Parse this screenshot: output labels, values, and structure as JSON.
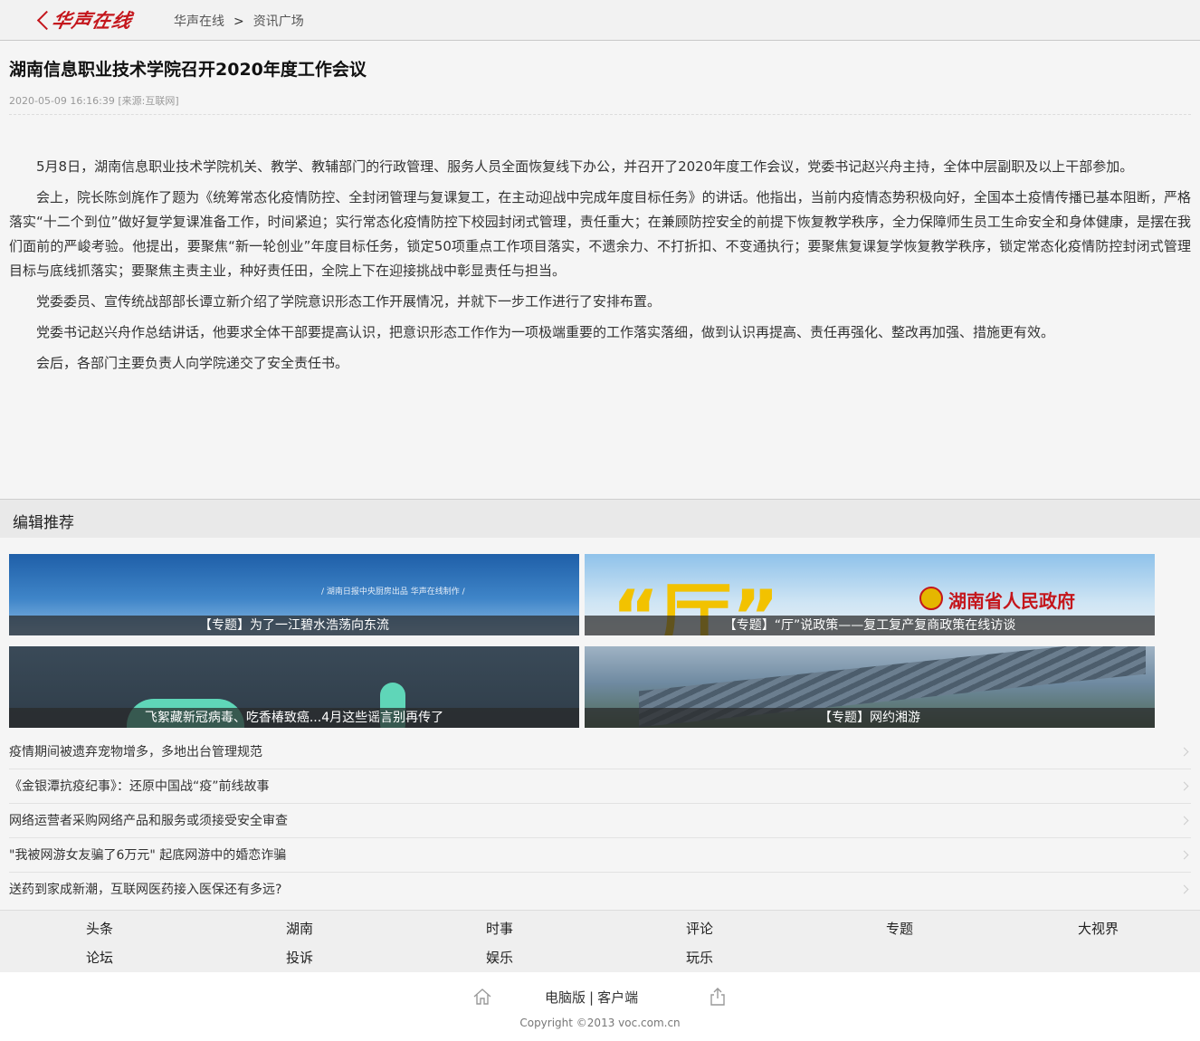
{
  "header": {
    "logo_text": "华声在线",
    "breadcrumb": [
      "华声在线",
      "资讯广场"
    ],
    "breadcrumb_sep": ">"
  },
  "article": {
    "title": "湖南信息职业技术学院召开2020年度工作会议",
    "meta": "2020-05-09 16:16:39 [来源:互联网]",
    "paragraphs": [
      "5月8日，湖南信息职业技术学院机关、教学、教辅部门的行政管理、服务人员全面恢复线下办公，并召开了2020年度工作会议，党委书记赵兴舟主持，全体中层副职及以上干部参加。",
      "会上，院长陈剑旄作了题为《统筹常态化疫情防控、全封闭管理与复课复工，在主动迎战中完成年度目标任务》的讲话。他指出，当前内疫情态势积极向好，全国本土疫情传播已基本阻断，严格落实“十二个到位”做好复学复课准备工作，时间紧迫；实行常态化疫情防控下校园封闭式管理，责任重大；在兼顾防控安全的前提下恢复教学秩序，全力保障师生员工生命安全和身体健康，是摆在我们面前的严峻考验。他提出，要聚焦“新一轮创业”年度目标任务，锁定50项重点工作项目落实，不遗余力、不打折扣、不变通执行；要聚焦复课复学恢复教学秩序，锁定常态化疫情防控封闭式管理目标与底线抓落实；要聚焦主责主业，种好责任田，全院上下在迎接挑战中彰显责任与担当。",
      "党委委员、宣传统战部部长谭立新介绍了学院意识形态工作开展情况，并就下一步工作进行了安排布置。",
      "党委书记赵兴舟作总结讲话，他要求全体干部要提高认识，把意识形态工作作为一项极端重要的工作落实落细，做到认识再提高、责任再强化、整改再加强、措施更有效。",
      "会后，各部门主要负责人向学院递交了安全责任书。"
    ]
  },
  "recommend": {
    "heading": "编辑推荐",
    "tiles": [
      {
        "caption": "【专题】为了一江碧水浩荡向东流",
        "overlay": "/   湖南日报中央厨房出品   华声在线制作   /"
      },
      {
        "caption": "【专题】“厅”说政策——复工复产复商政策在线访谈",
        "overlay": "湖南省人民政府",
        "quote": "“厅”"
      },
      {
        "caption": "飞絮藏新冠病毒、吃香椿致癌...4月这些谣言别再传了"
      },
      {
        "caption": "【专题】网约湘游"
      }
    ],
    "list": [
      "疫情期间被遗弃宠物增多，多地出台管理规范",
      "《金银潭抗疫纪事》：还原中国战“疫”前线故事",
      "网络运营者采购网络产品和服务或须接受安全审查",
      "\"我被网游女友骗了6万元\" 起底网游中的婚恋诈骗",
      "送药到家成新潮，互联网医药接入医保还有多远?"
    ]
  },
  "nav": [
    "头条",
    "湖南",
    "时事",
    "评论",
    "专题",
    "大视界",
    "论坛",
    "投诉",
    "娱乐",
    "玩乐"
  ],
  "footer": {
    "desktop_label": "电脑版",
    "divider": "|",
    "client_label": "客户端",
    "copyright": "Copyright ©2013 voc.com.cn"
  },
  "colors": {
    "brand": "#c4161c"
  }
}
